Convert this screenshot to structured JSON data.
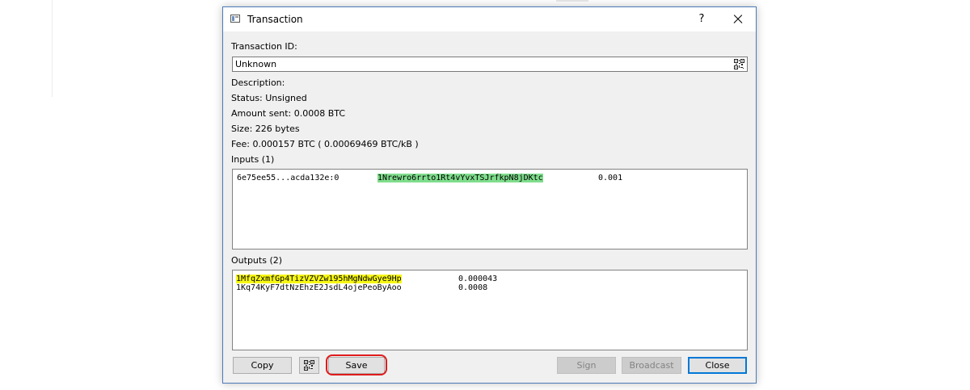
{
  "window": {
    "title": "Transaction",
    "help_symbol": "?"
  },
  "fields": {
    "transaction_id_label": "Transaction ID:",
    "transaction_id_value": "Unknown",
    "description": "Description:",
    "status": "Status: Unsigned",
    "amount_sent": "Amount sent: 0.0008 BTC",
    "size": "Size: 226 bytes",
    "fee": "Fee: 0.000157 BTC  ( 0.00069469 BTC/kB )"
  },
  "inputs": {
    "label": "Inputs (1)",
    "rows": [
      {
        "prevout": "6e75ee55...acda132e:0",
        "address": "1Nrewro6rrto1Rt4vYvxTSJrfkpN8jDKtc",
        "amount": "0.001",
        "highlight": "#7fdd8c"
      }
    ]
  },
  "outputs": {
    "label": "Outputs (2)",
    "rows": [
      {
        "address": "1MfqZxmfGp4TizVZVZw195hMgNdwGye9Hp",
        "amount": "0.000043",
        "highlight": "#f7f715"
      },
      {
        "address": "1Kq74KyF7dtNzEhzE2JsdL4ojePeoByAoo",
        "amount": "0.0008",
        "highlight": ""
      }
    ]
  },
  "buttons": {
    "copy": "Copy",
    "save": "Save",
    "sign": "Sign",
    "broadcast": "Broadcast",
    "close": "Close"
  },
  "icons": {
    "qr_field": "qr-code-icon",
    "qr_button": "qr-code-icon",
    "window": "app-window-icon",
    "close": "close-icon"
  },
  "colors": {
    "annotation_ring": "#e01b1b",
    "default_button_border": "#0078d7"
  }
}
